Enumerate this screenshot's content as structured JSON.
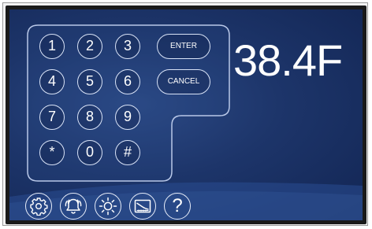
{
  "keypad": {
    "keys": [
      "1",
      "2",
      "3",
      "4",
      "5",
      "6",
      "7",
      "8",
      "9",
      "*",
      "0",
      "#"
    ],
    "enter_label": "ENTER",
    "cancel_label": "CANCEL"
  },
  "display": {
    "value": "38.4F"
  },
  "toolbar": {
    "icons": [
      "gear-icon",
      "bell-alarm-icon",
      "brightness-icon",
      "chart-icon",
      "help-icon"
    ],
    "help_label": "?"
  },
  "colors": {
    "screen_dark": "#122553",
    "screen_mid": "#1d356a",
    "outline": "#d9e3f7",
    "text": "#ffffff"
  }
}
